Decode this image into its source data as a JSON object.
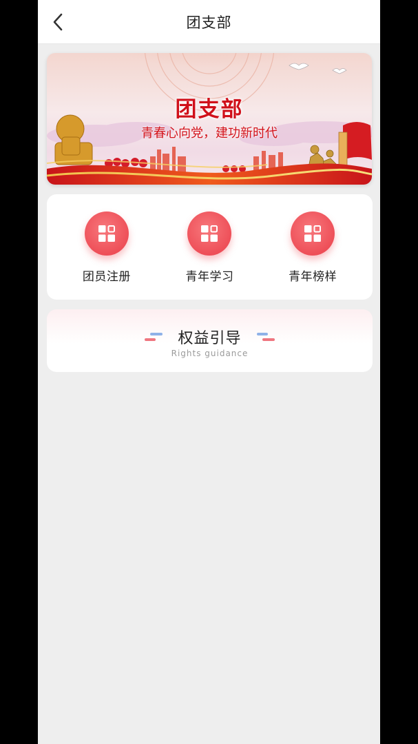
{
  "navbar": {
    "title": "团支部",
    "back_icon": "chevron-left-icon"
  },
  "banner": {
    "title": "团支部",
    "subtitle": "青春心向党，建功新时代"
  },
  "menu": {
    "items": [
      {
        "label": "团员注册",
        "icon": "grid-icon"
      },
      {
        "label": "青年学习",
        "icon": "grid-icon"
      },
      {
        "label": "青年榜样",
        "icon": "grid-icon"
      }
    ]
  },
  "rights": {
    "title": "权益引导",
    "subtitle": "Rights guidance"
  },
  "colors": {
    "accent": "#ee4f58",
    "banner_red": "#d0101a",
    "page_bg": "#eeeeee"
  }
}
